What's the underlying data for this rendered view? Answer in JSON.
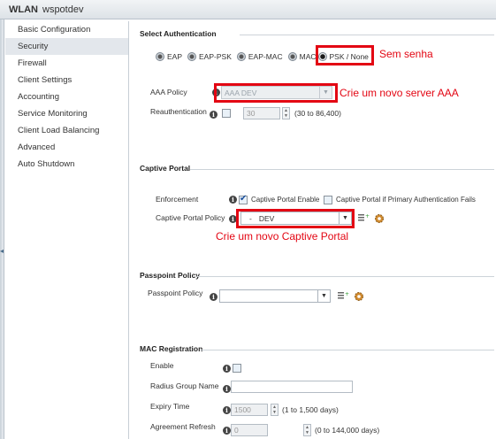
{
  "header": {
    "prefix": "WLAN",
    "name": "wspotdev"
  },
  "sidebar": {
    "items": [
      {
        "label": "Basic Configuration"
      },
      {
        "label": "Security"
      },
      {
        "label": "Firewall"
      },
      {
        "label": "Client Settings"
      },
      {
        "label": "Accounting"
      },
      {
        "label": "Service Monitoring"
      },
      {
        "label": "Client Load Balancing"
      },
      {
        "label": "Advanced"
      },
      {
        "label": "Auto Shutdown"
      }
    ],
    "active": "Security"
  },
  "auth": {
    "section": "Select Authentication",
    "options": [
      "EAP",
      "EAP-PSK",
      "EAP-MAC",
      "MAC",
      "PSK / None"
    ],
    "selected": "PSK / None",
    "aaa_label": "AAA Policy",
    "aaa_value": "AAA DEV",
    "reauth_label": "Reauthentication",
    "reauth_value": "30",
    "reauth_range": "(30 to 86,400)"
  },
  "captive": {
    "section": "Captive Portal",
    "enforcement_label": "Enforcement",
    "enable_label": "Captive Portal Enable",
    "if_primary_label": "Captive Portal if Primary Authentication Fails",
    "policy_label": "Captive Portal Policy",
    "policy_value": "DEV",
    "policy_prefix": "-"
  },
  "passpoint": {
    "section": "Passpoint Policy",
    "policy_label": "Passpoint Policy",
    "policy_value": ""
  },
  "mac": {
    "section": "MAC Registration",
    "enable_label": "Enable",
    "radius_label": "Radius Group Name",
    "radius_value": "",
    "expiry_label": "Expiry Time",
    "expiry_value": "1500",
    "expiry_range": "(1 to 1,500 days)",
    "refresh_label": "Agreement Refresh",
    "refresh_value": "0",
    "refresh_range": "(0 to 144,000 days)"
  },
  "annotations": {
    "psk": "Sem senha",
    "aaa": "Crie um novo server AAA",
    "captive": "Crie um novo Captive Portal"
  },
  "colors": {
    "annotation": "#e30613",
    "active_nav": "#e3e7ec",
    "check": "#1b4f9c"
  }
}
